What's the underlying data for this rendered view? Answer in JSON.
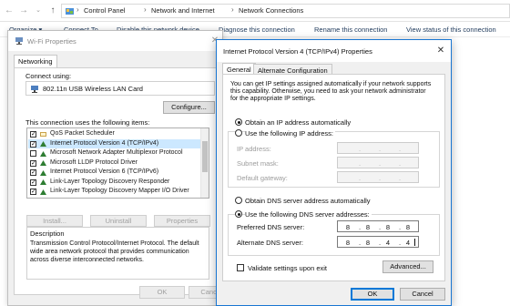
{
  "explorer": {
    "breadcrumbs": [
      "Control Panel",
      "Network and Internet",
      "Network Connections"
    ],
    "commands": [
      "Organize ▾",
      "Connect To",
      "Disable this network device",
      "Diagnose this connection",
      "Rename this connection",
      "View status of this connection"
    ]
  },
  "wifi": {
    "title": "Wi-Fi Properties",
    "tab": "Networking",
    "connect_using_label": "Connect using:",
    "adapter": "802.11n USB Wireless LAN Card",
    "configure": "Configure...",
    "items_label": "This connection uses the following items:",
    "components": [
      {
        "label": "QoS Packet Scheduler",
        "checked": true,
        "selected": false
      },
      {
        "label": "Internet Protocol Version 4 (TCP/IPv4)",
        "checked": true,
        "selected": true
      },
      {
        "label": "Microsoft Network Adapter Multiplexor Protocol",
        "checked": false,
        "selected": false
      },
      {
        "label": "Microsoft LLDP Protocol Driver",
        "checked": true,
        "selected": false
      },
      {
        "label": "Internet Protocol Version 6 (TCP/IPv6)",
        "checked": true,
        "selected": false
      },
      {
        "label": "Link-Layer Topology Discovery Responder",
        "checked": true,
        "selected": false
      },
      {
        "label": "Link-Layer Topology Discovery Mapper I/O Driver",
        "checked": true,
        "selected": false
      }
    ],
    "install": "Install...",
    "uninstall": "Uninstall",
    "properties": "Properties",
    "description_label": "Description",
    "description_lines": [
      "Transmission Control Protocol/Internet Protocol. The default",
      "wide area network protocol that provides communication",
      "across diverse interconnected networks."
    ],
    "ok": "OK",
    "cancel": "Cancel"
  },
  "ipv4": {
    "title": "Internet Protocol Version 4 (TCP/IPv4) Properties",
    "tabs": [
      "General",
      "Alternate Configuration"
    ],
    "intro_lines": [
      "You can get IP settings assigned automatically if your network supports",
      "this capability. Otherwise, you need to ask your network administrator",
      "for the appropriate IP settings."
    ],
    "obtain_ip_auto": "Obtain an IP address automatically",
    "use_following_ip": "Use the following IP address:",
    "ip_address_label": "IP address:",
    "subnet_label": "Subnet mask:",
    "gateway_label": "Default gateway:",
    "obtain_dns_auto": "Obtain DNS server address automatically",
    "use_following_dns": "Use the following DNS server addresses:",
    "preferred_dns_label": "Preferred DNS server:",
    "alternate_dns_label": "Alternate DNS server:",
    "preferred_dns": [
      "8",
      "8",
      "8",
      "8"
    ],
    "alternate_dns": [
      "8",
      "8",
      "4",
      "4"
    ],
    "validate_label": "Validate settings upon exit",
    "advanced": "Advanced...",
    "ok": "OK",
    "cancel": "Cancel",
    "selected_ip_mode": "auto",
    "selected_dns_mode": "manual",
    "validate_checked": false
  },
  "colors": {
    "accent": "#0078d7",
    "selection": "#cce8ff",
    "link_text": "#1e395b"
  }
}
